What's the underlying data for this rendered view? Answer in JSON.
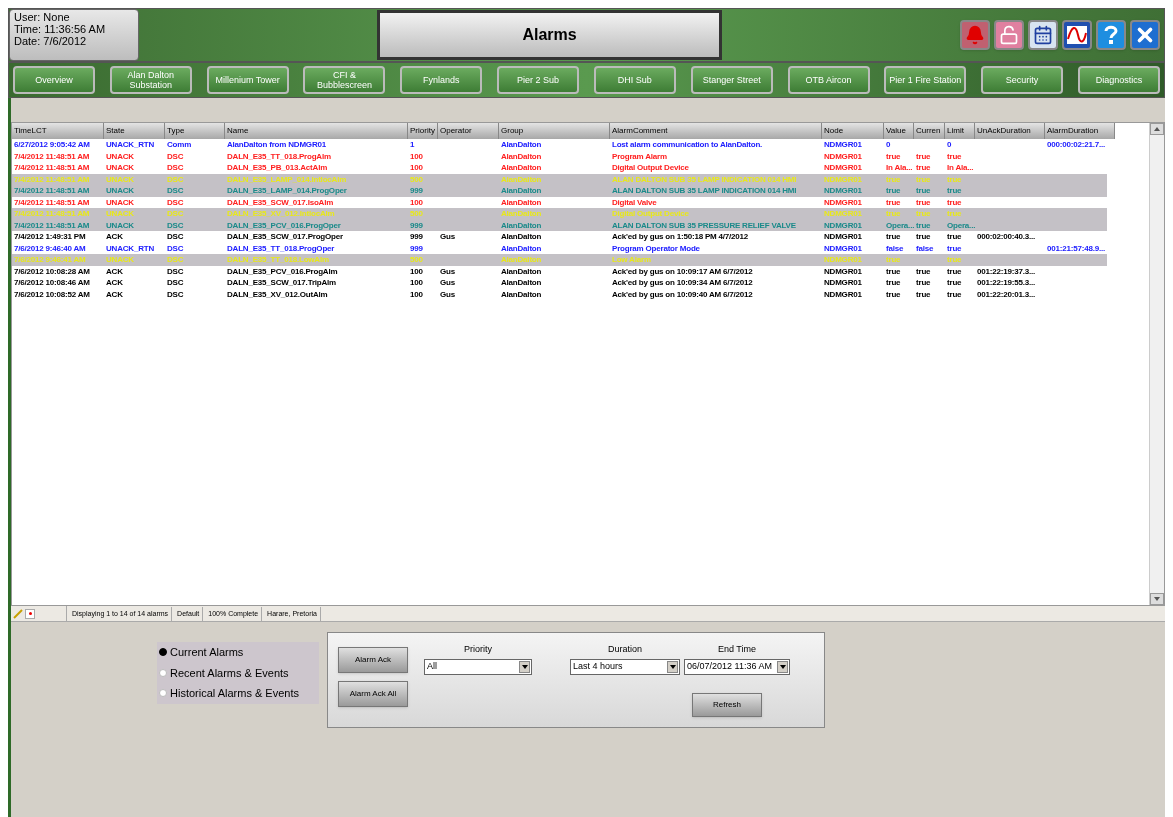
{
  "user_info": {
    "user": "User:  None",
    "time": "Time:  11:36:56 AM",
    "date": "Date:  7/6/2012"
  },
  "window": {
    "title": "Alarms"
  },
  "nav_buttons": [
    "Overview",
    "Alan Dalton\nSubstation",
    "Millenium Tower",
    "CFI &\nBubblescreen",
    "Fynlands",
    "Pier 2 Sub",
    "DHI Sub",
    "Stanger Street",
    "OTB Aircon",
    "Pier 1 Fire Station",
    "Security",
    "Diagnostics"
  ],
  "table": {
    "columns": [
      "TimeLCT",
      "State",
      "Type",
      "Name",
      "Priority",
      "Operator",
      "Group",
      "AlarmComment",
      "Node",
      "Value",
      "Curren",
      "Limit",
      "UnAckDuration",
      "AlarmDuration"
    ],
    "rows": [
      {
        "color": "#2020ff",
        "highlighted": false,
        "cells": [
          "6/27/2012 9:05:42 AM",
          "UNACK_RTN",
          "Comm",
          "AlanDalton from NDMGR01",
          "1",
          "",
          "AlanDalton",
          "Lost alarm communication to AlanDalton.",
          "NDMGR01",
          "0",
          "",
          "0",
          "",
          "000:00:02:21.7..."
        ]
      },
      {
        "color": "#ff2020",
        "highlighted": false,
        "cells": [
          "7/4/2012 11:48:51 AM",
          "UNACK",
          "DSC",
          "DALN_E35_TT_018.ProgAlm",
          "100",
          "",
          "AlanDalton",
          "Program Alarm",
          "NDMGR01",
          "true",
          "true",
          "true",
          "",
          ""
        ]
      },
      {
        "color": "#ff2020",
        "highlighted": false,
        "cells": [
          "7/4/2012 11:48:51 AM",
          "UNACK",
          "DSC",
          "DALN_E35_PB_013.ActAlm",
          "100",
          "",
          "AlanDalton",
          "Digital Output Device",
          "NDMGR01",
          "In Ala...",
          "true",
          "In Ala...",
          "",
          ""
        ]
      },
      {
        "color": "#e8e81a",
        "highlighted": true,
        "cells": [
          "7/4/2012 11:48:51 AM",
          "UNACK",
          "DSC",
          "DALN_E35_LAMP_014.IntlocAlm",
          "500",
          "",
          "AlanDalton",
          "ALAN DALTON SUB 35 LAMP INDICATION 014 HMI",
          "NDMGR01",
          "true",
          "true",
          "true",
          "",
          ""
        ]
      },
      {
        "color": "#1a8a8a",
        "highlighted": true,
        "cells": [
          "7/4/2012 11:48:51 AM",
          "UNACK",
          "DSC",
          "DALN_E35_LAMP_014.ProgOper",
          "999",
          "",
          "AlanDalton",
          "ALAN DALTON SUB 35 LAMP INDICATION 014 HMI",
          "NDMGR01",
          "true",
          "true",
          "true",
          "",
          ""
        ]
      },
      {
        "color": "#ff2020",
        "highlighted": false,
        "cells": [
          "7/4/2012 11:48:51 AM",
          "UNACK",
          "DSC",
          "DALN_E35_SCW_017.IsoAlm",
          "100",
          "",
          "AlanDalton",
          "Digital Valve",
          "NDMGR01",
          "true",
          "true",
          "true",
          "",
          ""
        ]
      },
      {
        "color": "#e8e81a",
        "highlighted": true,
        "cells": [
          "7/4/2012 11:48:51 AM",
          "UNACK",
          "DSC",
          "DALN_E35_XV_012.IntlocAlm",
          "500",
          "",
          "AlanDalton",
          "Digital Output Device",
          "NDMGR01",
          "true",
          "true",
          "true",
          "",
          ""
        ]
      },
      {
        "color": "#1a8a8a",
        "highlighted": true,
        "cells": [
          "7/4/2012 11:48:51 AM",
          "UNACK",
          "DSC",
          "DALN_E35_PCV_016.ProgOper",
          "999",
          "",
          "AlanDalton",
          "ALAN DALTON SUB 35 PRESSURE RELIEF VALVE",
          "NDMGR01",
          "Opera...",
          "true",
          "Opera...",
          "",
          ""
        ]
      },
      {
        "color": "#000000",
        "highlighted": false,
        "cells": [
          "7/4/2012 1:49:31 PM",
          "ACK",
          "DSC",
          "DALN_E35_SCW_017.ProgOper",
          "999",
          "Gus",
          "AlanDalton",
          "Ack'ed by gus on 1:50:18 PM 4/7/2012",
          "NDMGR01",
          "true",
          "true",
          "true",
          "000:02:00:40.3...",
          ""
        ]
      },
      {
        "color": "#2020ff",
        "highlighted": false,
        "cells": [
          "7/6/2012 9:46:40 AM",
          "UNACK_RTN",
          "DSC",
          "DALN_E35_TT_018.ProgOper",
          "999",
          "",
          "AlanDalton",
          "Program Operator Mode",
          "NDMGR01",
          "false",
          "false",
          "true",
          "",
          "001:21:57:48.9..."
        ]
      },
      {
        "color": "#e8e81a",
        "highlighted": true,
        "cells": [
          "7/6/2012 9:46:41 AM",
          "UNACK",
          "DSC",
          "DALN_E35_TT_018.LowAlm",
          "500",
          "",
          "AlanDalton",
          "Low Alarm",
          "NDMGR01",
          "true",
          "",
          "true",
          "",
          ""
        ]
      },
      {
        "color": "#000000",
        "highlighted": false,
        "cells": [
          "7/6/2012 10:08:28 AM",
          "ACK",
          "DSC",
          "DALN_E35_PCV_016.ProgAlm",
          "100",
          "Gus",
          "AlanDalton",
          "Ack'ed by gus on 10:09:17 AM 6/7/2012",
          "NDMGR01",
          "true",
          "true",
          "true",
          "001:22:19:37.3...",
          ""
        ]
      },
      {
        "color": "#000000",
        "highlighted": false,
        "cells": [
          "7/6/2012 10:08:46 AM",
          "ACK",
          "DSC",
          "DALN_E35_SCW_017.TripAlm",
          "100",
          "Gus",
          "AlanDalton",
          "Ack'ed by gus on 10:09:34 AM 6/7/2012",
          "NDMGR01",
          "true",
          "true",
          "true",
          "001:22:19:55.3...",
          ""
        ]
      },
      {
        "color": "#000000",
        "highlighted": false,
        "cells": [
          "7/6/2012 10:08:52 AM",
          "ACK",
          "DSC",
          "DALN_E35_XV_012.OutAlm",
          "100",
          "Gus",
          "AlanDalton",
          "Ack'ed by gus on 10:09:40 AM 6/7/2012",
          "NDMGR01",
          "true",
          "true",
          "true",
          "001:22:20:01.3...",
          ""
        ]
      }
    ]
  },
  "status_bar": [
    "Displaying 1 to 14 of 14 alarms",
    "Default",
    "100% Complete",
    "Harare, Pretoria"
  ],
  "view_options": [
    {
      "label": "Current Alarms",
      "selected": true
    },
    {
      "label": "Recent Alarms & Events",
      "selected": false
    },
    {
      "label": "Historical Alarms & Events",
      "selected": false
    }
  ],
  "buttons": {
    "ack": "Alarm Ack",
    "ack_all": "Alarm Ack All",
    "refresh": "Refresh"
  },
  "filters": [
    {
      "label": "Priority",
      "value": "All"
    },
    {
      "label": "Duration",
      "value": "Last 4 hours"
    },
    {
      "label": "End Time",
      "value": "06/07/2012 11:36 AM"
    }
  ]
}
